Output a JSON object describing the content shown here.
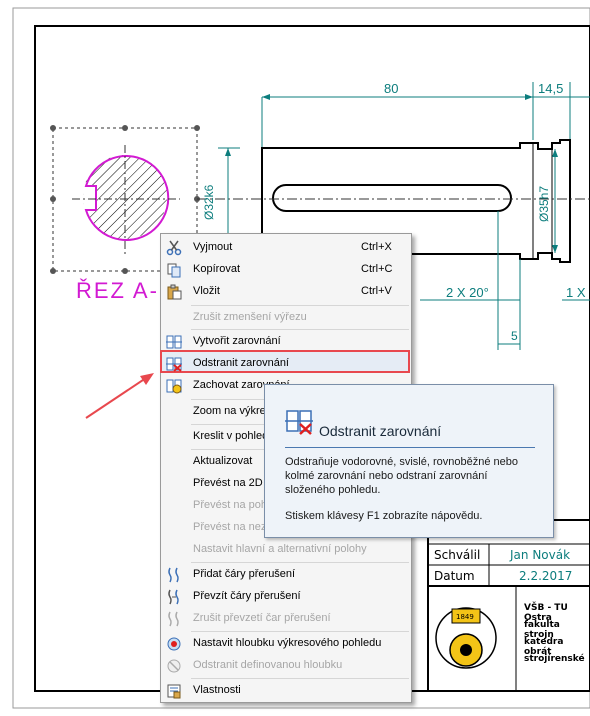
{
  "drawing": {
    "dims": [
      "80",
      "14,5",
      "Ø32k6",
      "Ø35h7",
      "2 X 20°",
      "1 X",
      "5"
    ],
    "section_label": "ŘEZ A-",
    "title_block": {
      "rows": [
        {
          "label": "Schválil",
          "value": "Jan Novák"
        },
        {
          "label": "Datum",
          "value": "2.2.2017"
        }
      ],
      "institution": [
        "VŠB - TU Ostra",
        "fakulta strojn",
        "katedra obrát",
        "strojírenské"
      ],
      "logo_year": "1849"
    }
  },
  "context_menu": {
    "items": [
      {
        "icon": "scissors-icon",
        "label": "Vyjmout",
        "shortcut": "Ctrl+X",
        "disabled": false
      },
      {
        "icon": "copy-icon",
        "label": "Kopírovat",
        "shortcut": "Ctrl+C",
        "disabled": false
      },
      {
        "icon": "paste-icon",
        "label": "Vložit",
        "shortcut": "Ctrl+V",
        "disabled": false
      },
      {
        "icon": "",
        "label": "Zrušit zmenšení výřezu",
        "shortcut": "",
        "disabled": true
      },
      {
        "icon": "align-create-icon",
        "label": "Vytvořit zarovnání",
        "shortcut": "",
        "disabled": false
      },
      {
        "icon": "align-remove-icon",
        "label": "Odstranit zarovnání",
        "shortcut": "",
        "disabled": false
      },
      {
        "icon": "align-keep-icon",
        "label": "Zachovat zarovnání",
        "shortcut": "",
        "disabled": false
      },
      {
        "icon": "",
        "label": "Zoom na výkre",
        "shortcut": "",
        "disabled": false
      },
      {
        "icon": "",
        "label": "Kreslit v pohled",
        "shortcut": "",
        "disabled": false
      },
      {
        "icon": "",
        "label": "Aktualizovat",
        "shortcut": "",
        "disabled": false
      },
      {
        "icon": "",
        "label": "Převést na 2D",
        "shortcut": "",
        "disabled": false
      },
      {
        "icon": "",
        "label": "Převést na poh",
        "shortcut": "",
        "disabled": true
      },
      {
        "icon": "",
        "label": "Převést na nez",
        "shortcut": "",
        "disabled": true
      },
      {
        "icon": "",
        "label": "Nastavit hlavní a alternativní polohy",
        "shortcut": "",
        "disabled": true
      },
      {
        "icon": "break-add-icon",
        "label": "Přidat čáry přerušení",
        "shortcut": "",
        "disabled": false
      },
      {
        "icon": "break-take-icon",
        "label": "Převzít čáry přerušení",
        "shortcut": "",
        "disabled": false
      },
      {
        "icon": "break-cancel-icon",
        "label": "Zrušit převzetí čar přerušení",
        "shortcut": "",
        "disabled": true
      },
      {
        "icon": "depth-set-icon",
        "label": "Nastavit hloubku výkresového pohledu",
        "shortcut": "",
        "disabled": false
      },
      {
        "icon": "depth-remove-icon",
        "label": "Odstranit definovanou hloubku",
        "shortcut": "",
        "disabled": true
      },
      {
        "icon": "properties-icon",
        "label": "Vlastnosti",
        "shortcut": "",
        "disabled": false
      }
    ],
    "highlighted": "Odstranit zarovnání"
  },
  "tooltip": {
    "title": "Odstranit zarovnání",
    "description": "Odstraňuje vodorovné, svislé, rovnoběžné nebo kolmé zarovnání nebo odstraní zarovnání složeného pohledu.",
    "help": "Stiskem klávesy F1 zobrazíte nápovědu."
  },
  "colors": {
    "highlight": "#e8484e",
    "arrow": "#e8484e",
    "section": "#d21ad2",
    "dimension": "#0c7d7d"
  }
}
